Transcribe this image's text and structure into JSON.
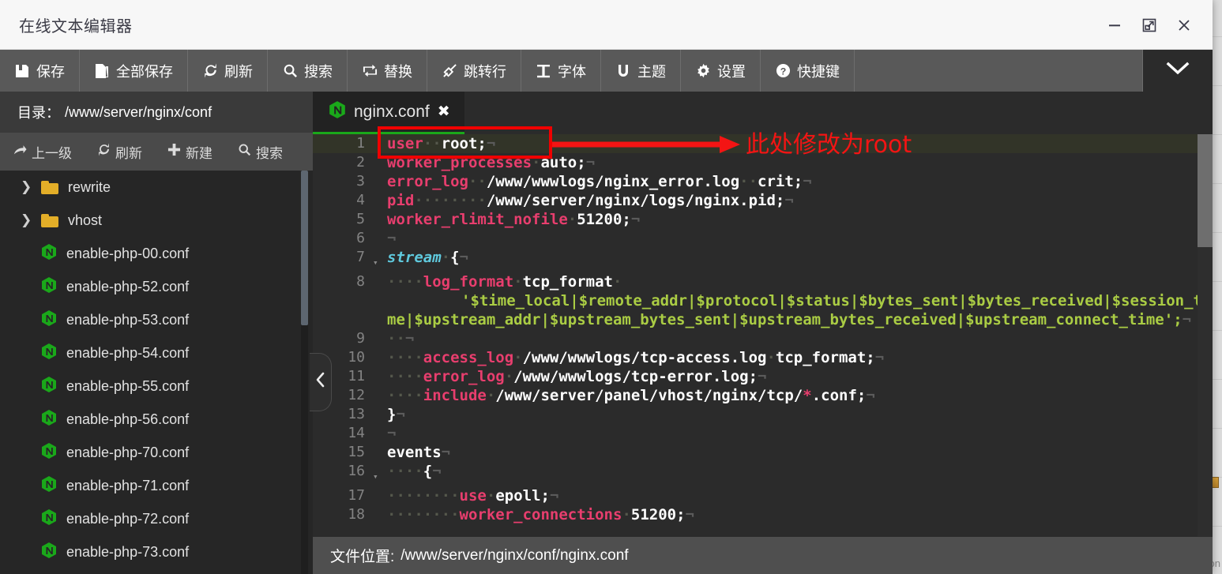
{
  "window": {
    "title": "在线文本编辑器",
    "controls": [
      {
        "name": "minimize",
        "glyph": "—"
      },
      {
        "name": "maximize",
        "glyph": "⤢"
      },
      {
        "name": "close",
        "glyph": "✕"
      }
    ]
  },
  "toolbar": {
    "items": [
      {
        "icon": "save-icon",
        "label": "保存"
      },
      {
        "icon": "save-all-icon",
        "label": "全部保存"
      },
      {
        "icon": "refresh-icon",
        "label": "刷新"
      },
      {
        "icon": "search-icon",
        "label": "搜索"
      },
      {
        "icon": "replace-icon",
        "label": "替换"
      },
      {
        "icon": "goto-line-icon",
        "label": "跳转行"
      },
      {
        "icon": "font-icon",
        "label": "字体"
      },
      {
        "icon": "theme-icon",
        "label": "主题"
      },
      {
        "icon": "settings-icon",
        "label": "设置"
      },
      {
        "icon": "shortcut-icon",
        "label": "快捷键"
      }
    ],
    "expand_caret": "chevron-down-icon"
  },
  "sidebar": {
    "dir_label": "目录：",
    "dir_path": "/www/server/nginx/conf",
    "actions": [
      {
        "icon": "up-level-icon",
        "label": "上一级"
      },
      {
        "icon": "refresh-icon",
        "label": "刷新"
      },
      {
        "icon": "plus-icon",
        "label": "新建"
      },
      {
        "icon": "search-icon",
        "label": "搜索"
      }
    ],
    "files": [
      {
        "type": "folder",
        "name": "rewrite"
      },
      {
        "type": "folder",
        "name": "vhost"
      },
      {
        "type": "file",
        "name": "enable-php-00.conf"
      },
      {
        "type": "file",
        "name": "enable-php-52.conf"
      },
      {
        "type": "file",
        "name": "enable-php-53.conf"
      },
      {
        "type": "file",
        "name": "enable-php-54.conf"
      },
      {
        "type": "file",
        "name": "enable-php-55.conf"
      },
      {
        "type": "file",
        "name": "enable-php-56.conf"
      },
      {
        "type": "file",
        "name": "enable-php-70.conf"
      },
      {
        "type": "file",
        "name": "enable-php-71.conf"
      },
      {
        "type": "file",
        "name": "enable-php-72.conf"
      },
      {
        "type": "file",
        "name": "enable-php-73.conf"
      }
    ],
    "collapse_handle": "chevron-left-icon"
  },
  "editor": {
    "tab": {
      "icon": "nginx-icon",
      "label": "nginx.conf",
      "close": "✖"
    },
    "lines": [
      {
        "num": "1",
        "fold": "",
        "active": true,
        "text": "user··root;"
      },
      {
        "num": "2",
        "fold": "",
        "active": false,
        "text": "worker_processes·auto;"
      },
      {
        "num": "3",
        "fold": "",
        "active": false,
        "text": "error_log··/www/wwwlogs/nginx_error.log··crit;"
      },
      {
        "num": "4",
        "fold": "",
        "active": false,
        "text": "pid········/www/server/nginx/logs/nginx.pid;"
      },
      {
        "num": "5",
        "fold": "",
        "active": false,
        "text": "worker_rlimit_nofile·51200;"
      },
      {
        "num": "6",
        "fold": "",
        "active": false,
        "text": ""
      },
      {
        "num": "7",
        "fold": "▾",
        "active": false,
        "text": "stream·{"
      },
      {
        "num": "8",
        "fold": "",
        "active": false,
        "text": "····log_format·tcp_format·'$time_local|$remote_addr|$protocol|$status|$bytes_sent|$bytes_received|$session_time|$upstream_addr|$upstream_bytes_sent|$upstream_bytes_received|$upstream_connect_time';"
      },
      {
        "num": "9",
        "fold": "",
        "active": false,
        "text": "··"
      },
      {
        "num": "10",
        "fold": "",
        "active": false,
        "text": "····access_log·/www/wwwlogs/tcp-access.log·tcp_format;"
      },
      {
        "num": "11",
        "fold": "",
        "active": false,
        "text": "····error_log·/www/wwwlogs/tcp-error.log;"
      },
      {
        "num": "12",
        "fold": "",
        "active": false,
        "text": "····include·/www/server/panel/vhost/nginx/tcp/*.conf;"
      },
      {
        "num": "13",
        "fold": "",
        "active": false,
        "text": "}"
      },
      {
        "num": "14",
        "fold": "",
        "active": false,
        "text": ""
      },
      {
        "num": "15",
        "fold": "",
        "active": false,
        "text": "events"
      },
      {
        "num": "16",
        "fold": "▾",
        "active": false,
        "text": "····{"
      },
      {
        "num": "17",
        "fold": "",
        "active": false,
        "text": "········use·epoll;"
      },
      {
        "num": "18",
        "fold": "",
        "active": false,
        "text": "········worker_connections·51200;"
      }
    ]
  },
  "annotation": {
    "text": "此处修改为root",
    "color": "#f41414"
  },
  "statusbar": {
    "label": "文件位置:",
    "path": "/www/server/nginx/conf/nginx.conf"
  },
  "watermark": {
    "text": "CSDN @It.Eason"
  },
  "colors": {
    "accent_green": "#1aa81a",
    "annotation_red": "#f41414",
    "directive_pink": "#e83e6e",
    "string_green": "#aacc44",
    "block_cyan": "#5fc9dd",
    "toolbar_bg": "#595959"
  }
}
